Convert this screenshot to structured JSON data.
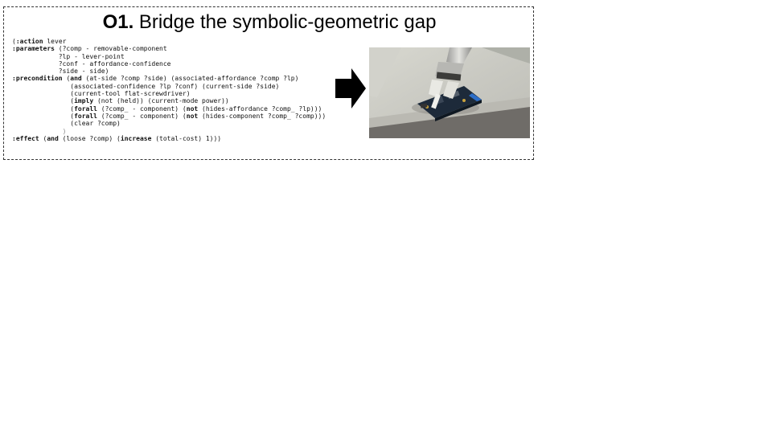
{
  "title": {
    "label": "O1.",
    "text": "Bridge the symbolic-geometric gap"
  },
  "pddl": {
    "l1": {
      "open": "(",
      "kw": ":action",
      "rest": " lever"
    },
    "l2": {
      "kw": ":parameters",
      "rest": " (?comp - removable-component"
    },
    "l3": "            ?lp - lever-point",
    "l4": "            ?conf - affordance-confidence",
    "l5": "            ?side - side)",
    "l6": {
      "kw": ":precondition",
      "open": " (",
      "and": "and",
      "rest": " (at-side ?comp ?side) (associated-affordance ?comp ?lp)"
    },
    "l7": "               (associated-confidence ?lp ?conf) (current-side ?side)",
    "l8": "               (current-tool flat-screwdriver)",
    "l9": {
      "pre": "               (",
      "kw": "imply",
      "rest": " (not (held)) (current-mode power))"
    },
    "l10": {
      "pre": "               (",
      "kw": "forall",
      "mid": " (?comp_ - component) (",
      "kw2": "not",
      "rest": " (hides-affordance ?comp_ ?lp)))"
    },
    "l11": {
      "pre": "               (",
      "kw": "forall",
      "mid": " (?comp_ - component) (",
      "kw2": "not",
      "rest": " (hides-component ?comp_ ?comp)))"
    },
    "l12": "               (clear ?comp)",
    "l13": "             )",
    "l14": {
      "kw": ":effect",
      "pre": " (",
      "and": "and",
      "mid": " (loose ?comp) (",
      "kw2": "increase",
      "rest": " (total-cost) 1)))"
    }
  },
  "arrow": {
    "icon": "right-arrow-icon",
    "color": "#000000"
  },
  "photo": {
    "subject": "robot-arm-with-screwdriver-on-circuit-board"
  }
}
